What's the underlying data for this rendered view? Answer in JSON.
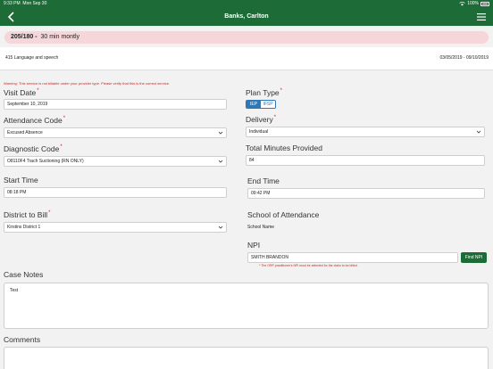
{
  "status_bar": {
    "time": "9:33 PM",
    "day": "Mon Sep 30",
    "battery": "100%"
  },
  "nav": {
    "title": "Banks, Carlton",
    "back_icon": "chevron-left-icon",
    "menu_icon": "hamburger-menu-icon"
  },
  "banner": {
    "code": "205/180 -",
    "text": "30 min montly"
  },
  "service": {
    "code_name": "415 Language and speech",
    "date_range": "03/05/2019 - 09/10/2019"
  },
  "warning": "Warning: This service is not billable under your provider type. Please verify that this is the correct service.",
  "form": {
    "visit_date": {
      "label": "Visit Date",
      "value": "September 10, 2019"
    },
    "attendance_code": {
      "label": "Attendance Code",
      "value": "Excused Absence"
    },
    "diagnostic_code": {
      "label": "Diagnostic Code",
      "value": "O8110F4 Trach Suctioning (RN ONLY)"
    },
    "start_time": {
      "label": "Start Time",
      "value": "08:18 PM"
    },
    "district": {
      "label": "District to Bill",
      "value": "Kirstins District 1"
    },
    "plan_type": {
      "label": "Plan Type",
      "options": [
        "IEP",
        "IFSP"
      ],
      "selected": "IEP"
    },
    "delivery": {
      "label": "Delivery",
      "value": "Individual"
    },
    "total_minutes": {
      "label": "Total Minutes Provided",
      "value": "84"
    },
    "end_time": {
      "label": "End Time",
      "value": "09:42 PM"
    },
    "school": {
      "label": "School of Attendance",
      "value": "School Name"
    },
    "npi": {
      "label": "NPI",
      "value": "SMITH BRANDON",
      "button": "Find NPI",
      "hint": "* The ORP practitioner's NPI must be selected for the claim to be billed."
    },
    "case_notes": {
      "label": "Case Notes",
      "value": "Test"
    },
    "comments": {
      "label": "Comments",
      "value": ""
    }
  },
  "colors": {
    "header": "#1d6b37",
    "banner": "#f6d6d9",
    "warning": "#d32323",
    "segment": "#2f78b7"
  }
}
